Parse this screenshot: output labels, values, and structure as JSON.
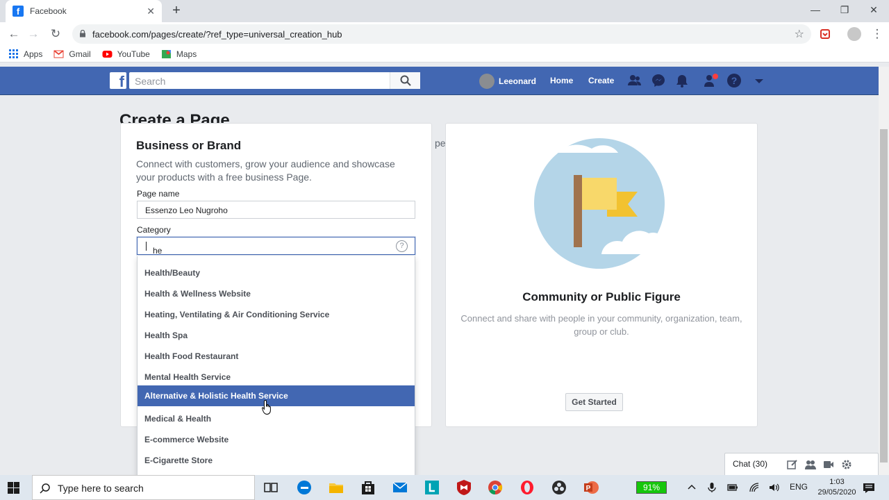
{
  "browser": {
    "tab_title": "Facebook",
    "tab_close": "✕",
    "new_tab": "+",
    "url": "facebook.com/pages/create/?ref_type=universal_creation_hub",
    "bookmarks": [
      "Apps",
      "Gmail",
      "YouTube",
      "Maps"
    ],
    "window_controls": {
      "minimize": "—",
      "restore": "❐",
      "close": "✕"
    }
  },
  "fb_header": {
    "search_placeholder": "Search",
    "user_name": "Leeonard",
    "home": "Home",
    "create": "Create"
  },
  "page": {
    "title": "Create a Page",
    "left_card": {
      "title": "Business or Brand",
      "description": "Connect with customers, grow your audience and showcase your products with a free business Page.",
      "page_name_label": "Page name",
      "page_name_value": "Essenzo Leo Nugroho",
      "category_label": "Category",
      "category_value": "he",
      "help": "?"
    },
    "peek_text": "pe",
    "dropdown": [
      "Health/Beauty",
      "Health & Wellness Website",
      "Heating, Ventilating & Air Conditioning Service",
      "Health Spa",
      "Health Food Restaurant",
      "Mental Health Service",
      "Alternative & Holistic Health Service",
      "Medical & Health",
      "E-commerce Website",
      "E-Cigarette Store"
    ],
    "dropdown_selected_index": 6,
    "right_card": {
      "title": "Community or Public Figure",
      "description": "Connect and share with people in your community, organization, team, group or club.",
      "button": "Get Started"
    }
  },
  "chat": {
    "label": "Chat (30)"
  },
  "taskbar": {
    "search_placeholder": "Type here to search",
    "battery": "91%",
    "language": "ENG",
    "time": "1:03",
    "date": "29/05/2020"
  },
  "colors": {
    "fb_blue": "#4267b2",
    "selected": "#4267b2",
    "chrome_tabstrip": "#dee1e6"
  }
}
